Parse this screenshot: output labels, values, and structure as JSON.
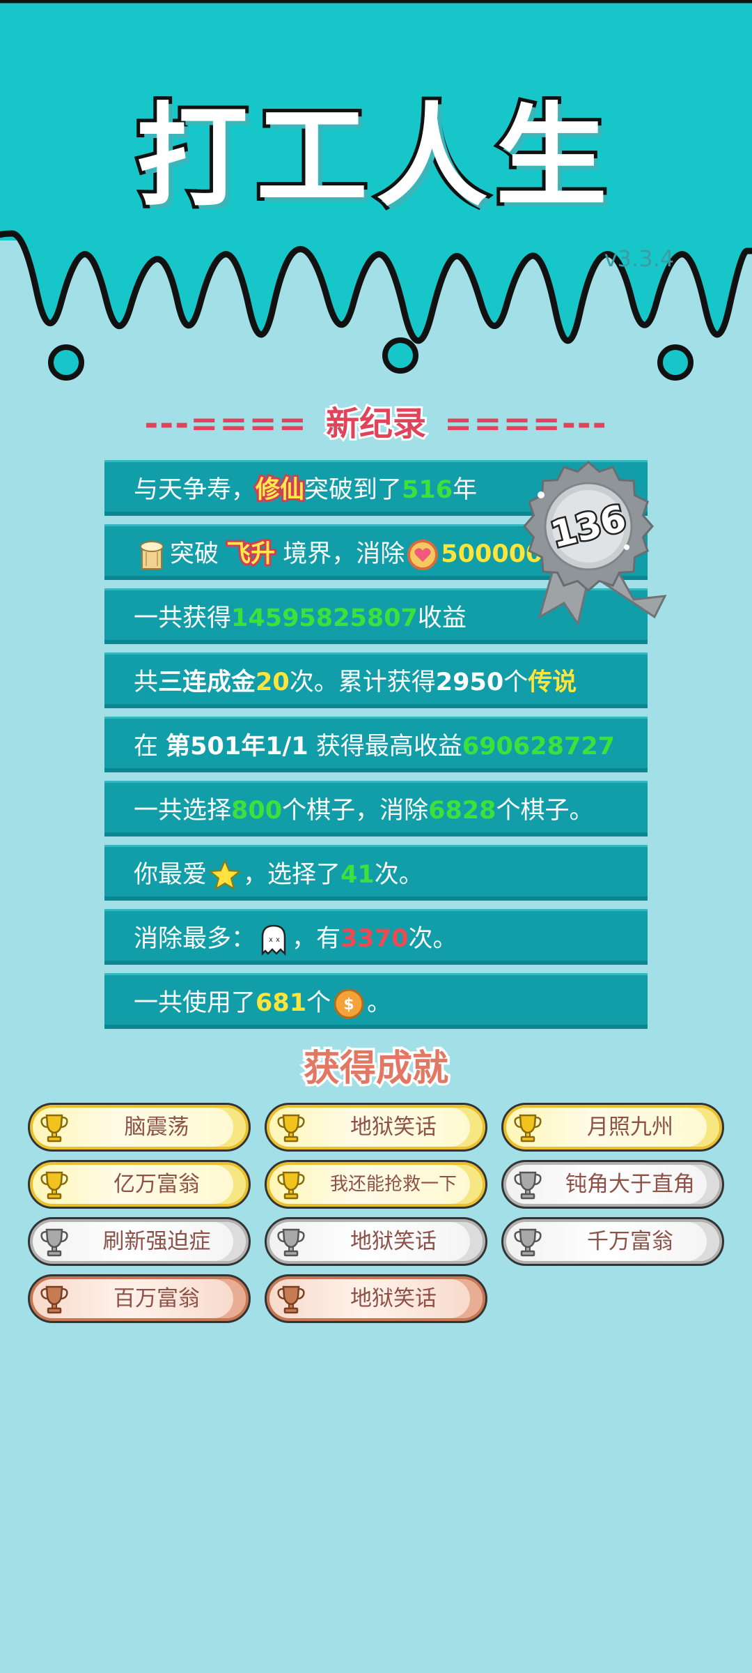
{
  "app": {
    "title": "打工人生",
    "version": "v3.3.4"
  },
  "colors": {
    "background": "#a3dfe6",
    "header": "#16c6c9",
    "row": "#119ea8",
    "green": "#3ee03b",
    "yellow": "#ffe53b",
    "red": "#ef4a52"
  },
  "new_record": {
    "left": "---====",
    "title": "新纪录",
    "right": "====---"
  },
  "medal": {
    "value": "136"
  },
  "rows": [
    {
      "parts": [
        {
          "t": "与天争寿，"
        },
        {
          "t": "修仙",
          "c": "tag"
        },
        {
          "t": "突破到了"
        },
        {
          "t": "516",
          "c": "g"
        },
        {
          "t": "年"
        }
      ]
    },
    {
      "parts": [
        {
          "icon": "scroll-icon"
        },
        {
          "t": "突破 "
        },
        {
          "t": "飞升",
          "c": "tag"
        },
        {
          "t": " 境界，消除"
        },
        {
          "icon": "heart-coin-icon"
        },
        {
          "t": "500000",
          "c": "y"
        }
      ]
    },
    {
      "parts": [
        {
          "t": "一共获得"
        },
        {
          "t": "14595825807",
          "c": "g"
        },
        {
          "t": "收益"
        }
      ]
    },
    {
      "parts": [
        {
          "t": "共"
        },
        {
          "t": "三连成金",
          "c": "w"
        },
        {
          "t": "20",
          "c": "y"
        },
        {
          "t": "次。累计获得"
        },
        {
          "t": "2950",
          "c": "w"
        },
        {
          "t": "个"
        },
        {
          "t": "传说",
          "c": "y"
        }
      ]
    },
    {
      "parts": [
        {
          "t": "在 "
        },
        {
          "t": "第501年1/1",
          "c": "w"
        },
        {
          "t": " 获得最高收益"
        },
        {
          "t": "690628727",
          "c": "g"
        }
      ]
    },
    {
      "parts": [
        {
          "t": "一共选择"
        },
        {
          "t": "800",
          "c": "g"
        },
        {
          "t": "个棋子，消除"
        },
        {
          "t": "6828",
          "c": "g"
        },
        {
          "t": "个棋子。"
        }
      ]
    },
    {
      "parts": [
        {
          "t": "你最爱"
        },
        {
          "icon": "star-icon"
        },
        {
          "t": "，选择了"
        },
        {
          "t": "41",
          "c": "g"
        },
        {
          "t": "次。"
        }
      ]
    },
    {
      "parts": [
        {
          "t": "消除最多："
        },
        {
          "icon": "ghost-icon"
        },
        {
          "t": "，有"
        },
        {
          "t": "3370",
          "c": "r"
        },
        {
          "t": "次。"
        }
      ]
    },
    {
      "parts": [
        {
          "t": "一共使用了"
        },
        {
          "t": "681",
          "c": "y"
        },
        {
          "t": "个"
        },
        {
          "icon": "coin-icon"
        },
        {
          "t": "。"
        }
      ]
    }
  ],
  "achievements": {
    "title": "获得成就",
    "items": [
      {
        "label": "脑震荡",
        "tier": "gold"
      },
      {
        "label": "地狱笑话",
        "tier": "gold"
      },
      {
        "label": "月照九州",
        "tier": "gold"
      },
      {
        "label": "亿万富翁",
        "tier": "gold"
      },
      {
        "label": "我还能抢救一下",
        "tier": "gold"
      },
      {
        "label": "钝角大于直角",
        "tier": "silver"
      },
      {
        "label": "刷新强迫症",
        "tier": "silver"
      },
      {
        "label": "地狱笑话",
        "tier": "silver"
      },
      {
        "label": "千万富翁",
        "tier": "silver"
      },
      {
        "label": "百万富翁",
        "tier": "bronze"
      },
      {
        "label": "地狱笑话",
        "tier": "bronze"
      }
    ]
  }
}
